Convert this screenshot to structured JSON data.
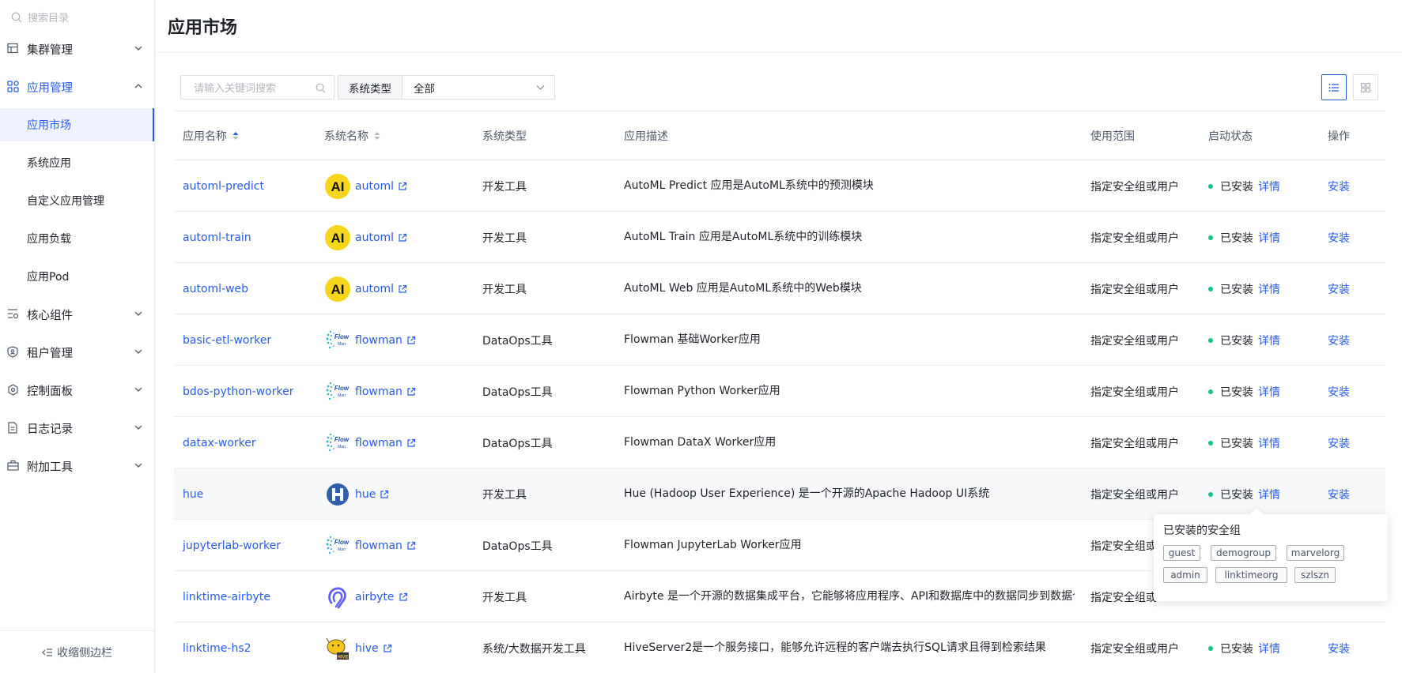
{
  "sidebar": {
    "search_placeholder": "搜索目录",
    "menu": {
      "cluster": "集群管理",
      "app": "应用管理",
      "core": "核心组件",
      "tenant": "租户管理",
      "control": "控制面板",
      "log": "日志记录",
      "tools": "附加工具"
    },
    "sub": {
      "market": "应用市场",
      "system": "系统应用",
      "custom": "自定义应用管理",
      "load": "应用负载",
      "pod": "应用Pod"
    },
    "collapse_label": "收缩侧边栏"
  },
  "header": {
    "title": "应用市场"
  },
  "filter": {
    "keyword_placeholder": "请输入关键词搜索",
    "type_label": "系统类型",
    "type_value": "全部"
  },
  "table": {
    "headers": {
      "app_name": "应用名称",
      "sys_name": "系统名称",
      "sys_type": "系统类型",
      "desc": "应用描述",
      "scope": "使用范围",
      "status": "启动状态",
      "action": "操作"
    },
    "rows": [
      {
        "name": "automl-predict",
        "sys": "automl",
        "type": "开发工具",
        "desc": "AutoML Predict 应用是AutoML系统中的预测模块",
        "scope": "指定安全组或用户",
        "status": "已安装",
        "detail": "详情",
        "action": "安装"
      },
      {
        "name": "automl-train",
        "sys": "automl",
        "type": "开发工具",
        "desc": "AutoML Train 应用是AutoML系统中的训练模块",
        "scope": "指定安全组或用户",
        "status": "已安装",
        "detail": "详情",
        "action": "安装"
      },
      {
        "name": "automl-web",
        "sys": "automl",
        "type": "开发工具",
        "desc": "AutoML Web 应用是AutoML系统中的Web模块",
        "scope": "指定安全组或用户",
        "status": "已安装",
        "detail": "详情",
        "action": "安装"
      },
      {
        "name": "basic-etl-worker",
        "sys": "flowman",
        "type": "DataOps工具",
        "desc": "Flowman 基础Worker应用",
        "scope": "指定安全组或用户",
        "status": "已安装",
        "detail": "详情",
        "action": "安装"
      },
      {
        "name": "bdos-python-worker",
        "sys": "flowman",
        "type": "DataOps工具",
        "desc": "Flowman Python Worker应用",
        "scope": "指定安全组或用户",
        "status": "已安装",
        "detail": "详情",
        "action": "安装"
      },
      {
        "name": "datax-worker",
        "sys": "flowman",
        "type": "DataOps工具",
        "desc": "Flowman DataX Worker应用",
        "scope": "指定安全组或用户",
        "status": "已安装",
        "detail": "详情",
        "action": "安装"
      },
      {
        "name": "hue",
        "sys": "hue",
        "type": "开发工具",
        "desc": "Hue (Hadoop User Experience) 是一个开源的Apache Hadoop UI系统",
        "scope": "指定安全组或用户",
        "status": "已安装",
        "detail": "详情",
        "action": "安装"
      },
      {
        "name": "jupyterlab-worker",
        "sys": "flowman",
        "type": "DataOps工具",
        "desc": "Flowman JupyterLab Worker应用",
        "scope": "指定安全组或"
      },
      {
        "name": "linktime-airbyte",
        "sys": "airbyte",
        "type": "开发工具",
        "desc": "Airbyte 是一个开源的数据集成平台，它能够将应用程序、API和数据库中的数据同步到数据仓库、数据湖和其他目的地",
        "scope": "指定安全组或"
      },
      {
        "name": "linktime-hs2",
        "sys": "hive",
        "type": "系统/大数据开发工具",
        "desc": "HiveServer2是一个服务接口，能够允许远程的客户端去执行SQL请求且得到检索结果",
        "scope": "指定安全组或用户",
        "status": "已安装",
        "detail": "详情",
        "action": "安装"
      }
    ]
  },
  "popover": {
    "title": "已安装的安全组",
    "tags": [
      "guest",
      "demogroup",
      "marvelorg",
      "admin",
      "linktimeorg",
      "szlszn"
    ]
  },
  "colors": {
    "accent": "#2b5ce6",
    "installed": "#14c08b"
  }
}
